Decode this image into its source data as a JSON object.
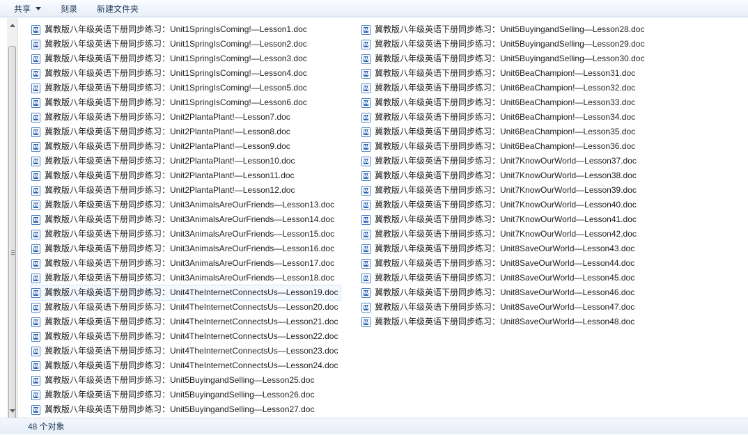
{
  "toolbar": {
    "share": "共享",
    "burn": "刻录",
    "new_folder": "新建文件夹"
  },
  "status": {
    "count": "48 个对象"
  },
  "files": {
    "col1": [
      "冀教版八年级英语下册同步练习：Unit1SpringIsComing!—Lesson1.doc",
      "冀教版八年级英语下册同步练习：Unit1SpringIsComing!—Lesson2.doc",
      "冀教版八年级英语下册同步练习：Unit1SpringIsComing!—Lesson3.doc",
      "冀教版八年级英语下册同步练习：Unit1SpringIsComing!—Lesson4.doc",
      "冀教版八年级英语下册同步练习：Unit1SpringIsComing!—Lesson5.doc",
      "冀教版八年级英语下册同步练习：Unit1SpringIsComing!—Lesson6.doc",
      "冀教版八年级英语下册同步练习：Unit2PlantaPlant!—Lesson7.doc",
      "冀教版八年级英语下册同步练习：Unit2PlantaPlant!—Lesson8.doc",
      "冀教版八年级英语下册同步练习：Unit2PlantaPlant!—Lesson9.doc",
      "冀教版八年级英语下册同步练习：Unit2PlantaPlant!—Lesson10.doc",
      "冀教版八年级英语下册同步练习：Unit2PlantaPlant!—Lesson11.doc",
      "冀教版八年级英语下册同步练习：Unit2PlantaPlant!—Lesson12.doc",
      "冀教版八年级英语下册同步练习：Unit3AnimalsAreOurFriends—Lesson13.doc",
      "冀教版八年级英语下册同步练习：Unit3AnimalsAreOurFriends—Lesson14.doc",
      "冀教版八年级英语下册同步练习：Unit3AnimalsAreOurFriends—Lesson15.doc",
      "冀教版八年级英语下册同步练习：Unit3AnimalsAreOurFriends—Lesson16.doc",
      "冀教版八年级英语下册同步练习：Unit3AnimalsAreOurFriends—Lesson17.doc",
      "冀教版八年级英语下册同步练习：Unit3AnimalsAreOurFriends—Lesson18.doc",
      "冀教版八年级英语下册同步练习：Unit4TheInternetConnectsUs—Lesson19.doc",
      "冀教版八年级英语下册同步练习：Unit4TheInternetConnectsUs—Lesson20.doc",
      "冀教版八年级英语下册同步练习：Unit4TheInternetConnectsUs—Lesson21.doc",
      "冀教版八年级英语下册同步练习：Unit4TheInternetConnectsUs—Lesson22.doc",
      "冀教版八年级英语下册同步练习：Unit4TheInternetConnectsUs—Lesson23.doc",
      "冀教版八年级英语下册同步练习：Unit4TheInternetConnectsUs—Lesson24.doc",
      "冀教版八年级英语下册同步练习：Unit5BuyingandSelling—Lesson25.doc",
      "冀教版八年级英语下册同步练习：Unit5BuyingandSelling—Lesson26.doc",
      "冀教版八年级英语下册同步练习：Unit5BuyingandSelling—Lesson27.doc"
    ],
    "col2": [
      "冀教版八年级英语下册同步练习：Unit5BuyingandSelling—Lesson28.doc",
      "冀教版八年级英语下册同步练习：Unit5BuyingandSelling—Lesson29.doc",
      "冀教版八年级英语下册同步练习：Unit5BuyingandSelling—Lesson30.doc",
      "冀教版八年级英语下册同步练习：Unit6BeaChampion!—Lesson31.doc",
      "冀教版八年级英语下册同步练习：Unit6BeaChampion!—Lesson32.doc",
      "冀教版八年级英语下册同步练习：Unit6BeaChampion!—Lesson33.doc",
      "冀教版八年级英语下册同步练习：Unit6BeaChampion!—Lesson34.doc",
      "冀教版八年级英语下册同步练习：Unit6BeaChampion!—Lesson35.doc",
      "冀教版八年级英语下册同步练习：Unit6BeaChampion!—Lesson36.doc",
      "冀教版八年级英语下册同步练习：Unit7KnowOurWorld—Lesson37.doc",
      "冀教版八年级英语下册同步练习：Unit7KnowOurWorld—Lesson38.doc",
      "冀教版八年级英语下册同步练习：Unit7KnowOurWorld—Lesson39.doc",
      "冀教版八年级英语下册同步练习：Unit7KnowOurWorld—Lesson40.doc",
      "冀教版八年级英语下册同步练习：Unit7KnowOurWorld—Lesson41.doc",
      "冀教版八年级英语下册同步练习：Unit7KnowOurWorld—Lesson42.doc",
      "冀教版八年级英语下册同步练习：Unit8SaveOurWorld—Lesson43.doc",
      "冀教版八年级英语下册同步练习：Unit8SaveOurWorld—Lesson44.doc",
      "冀教版八年级英语下册同步练习：Unit8SaveOurWorld—Lesson45.doc",
      "冀教版八年级英语下册同步练习：Unit8SaveOurWorld—Lesson46.doc",
      "冀教版八年级英语下册同步练习：Unit8SaveOurWorld—Lesson47.doc",
      "冀教版八年级英语下册同步练习：Unit8SaveOurWorld—Lesson48.doc"
    ]
  },
  "icons": {
    "file": "word-doc-icon"
  }
}
